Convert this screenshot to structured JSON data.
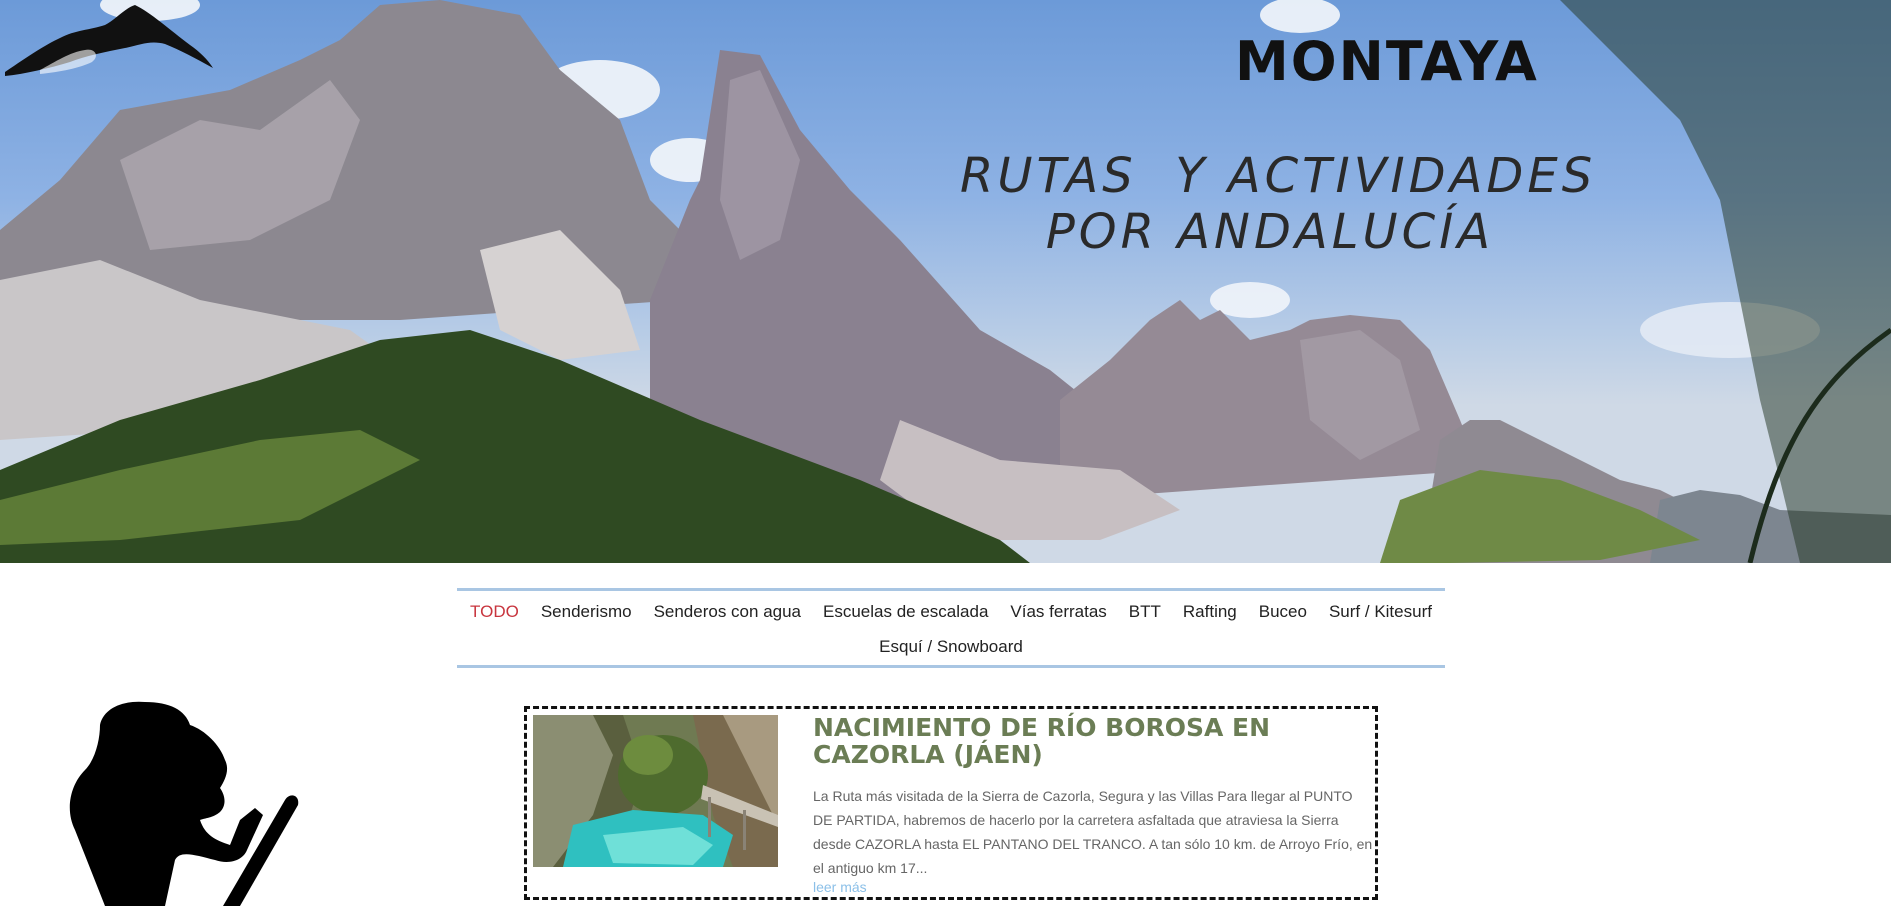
{
  "header": {
    "brand_name": "MONTAYA",
    "tagline_line1": "RUTAS  Y ACTIVIDADES",
    "tagline_line2": "POR ANDALUCÍA"
  },
  "nav": {
    "row1": [
      "TODO",
      "Senderismo",
      "Senderos con agua",
      "Escuelas de escalada",
      "Vías ferratas",
      "BTT",
      "Rafting",
      "Buceo",
      "Surf / Kitesurf"
    ],
    "row2": [
      "Esquí / Snowboard"
    ],
    "active": "TODO"
  },
  "post": {
    "title": "NACIMIENTO DE RÍO BOROSA EN CAZORLA (JÁEN)",
    "excerpt": "La Ruta más visitada de la Sierra de Cazorla, Segura y las Villas Para llegar al PUNTO DE PARTIDA, habremos de hacerlo por la carretera asfaltada que atraviesa la Sierra desde CAZORLA hasta EL PANTANO DEL TRANCO. A tan sólo 10 km. de Arroyo Frío, en el antiguo km 17...",
    "read_more": "leer más"
  },
  "colors": {
    "nav_border": "#a9c6e3",
    "active_nav": "#c8353e",
    "post_title": "#6b7d55",
    "read_more": "#8cc0e8"
  }
}
